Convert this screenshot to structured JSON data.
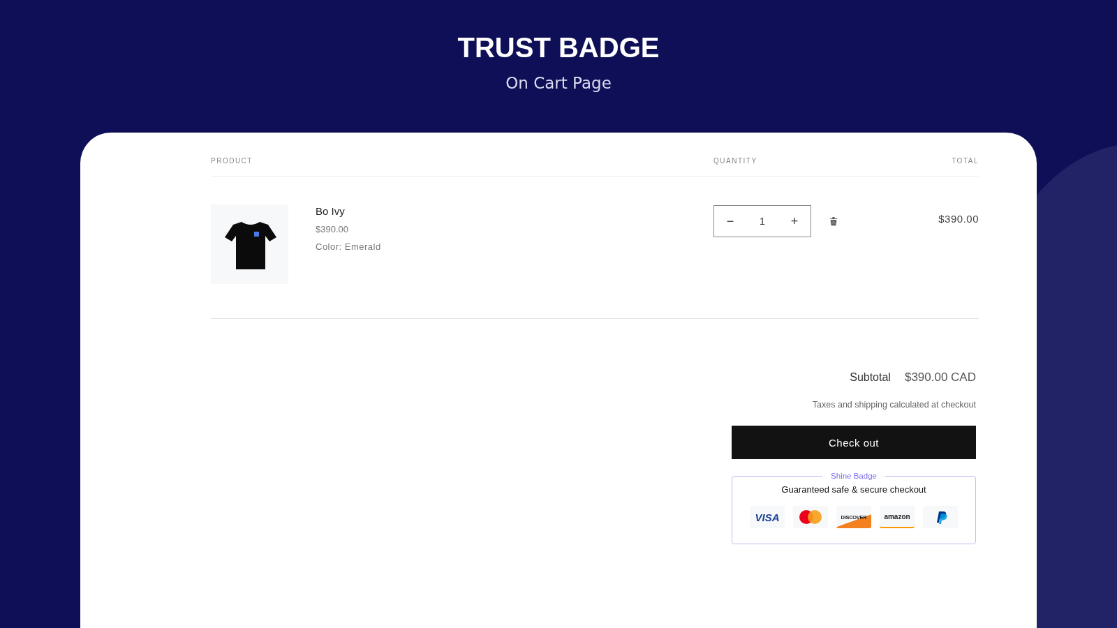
{
  "header": {
    "title": "TRUST BADGE",
    "subtitle": "On Cart Page"
  },
  "cart": {
    "columns": [
      "PRODUCT",
      "QUANTITY",
      "TOTAL"
    ],
    "items": [
      {
        "name": "Bo Ivy",
        "price": "$390.00",
        "option": "Color: Emerald",
        "quantity": "1",
        "total": "$390.00",
        "minus": "−",
        "plus": "+"
      }
    ],
    "subtotal_label": "Subtotal",
    "subtotal": "$390.00 CAD",
    "note": "Taxes and shipping calculated at checkout",
    "checkout": "Check out"
  },
  "badge": {
    "legend": "Shine Badge",
    "heading": "Guaranteed safe & secure checkout",
    "payments": [
      {
        "kind": "visa",
        "label": "VISA"
      },
      {
        "kind": "mastercard"
      },
      {
        "kind": "discover",
        "label": "DISCOVER"
      },
      {
        "kind": "amazon",
        "label": "amazon"
      },
      {
        "kind": "paypal"
      }
    ]
  }
}
